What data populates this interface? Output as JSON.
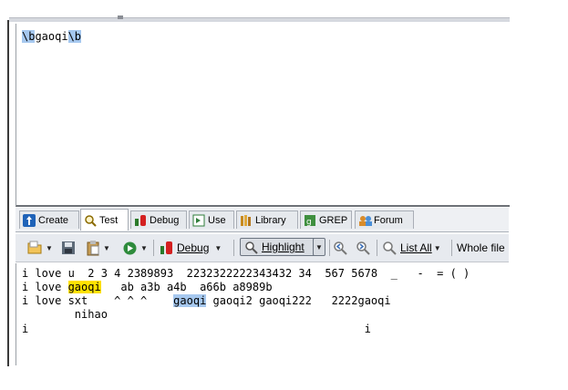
{
  "regex": {
    "pattern_parts": [
      {
        "text": "\\b",
        "highlight": "blue"
      },
      {
        "text": "gaoqi",
        "highlight": "none"
      },
      {
        "text": "\\b",
        "highlight": "blue"
      }
    ]
  },
  "tabs": [
    {
      "label": "Create",
      "icon": "create-icon",
      "active": false
    },
    {
      "label": "Test",
      "icon": "magnifier-icon",
      "active": true
    },
    {
      "label": "Debug",
      "icon": "debug-icon",
      "active": false
    },
    {
      "label": "Use",
      "icon": "use-icon",
      "active": false
    },
    {
      "label": "Library",
      "icon": "library-icon",
      "active": false
    },
    {
      "label": "GREP",
      "icon": "grep-icon",
      "active": false
    },
    {
      "label": "Forum",
      "icon": "forum-icon",
      "active": false
    }
  ],
  "toolbar": {
    "debug_label": "Debug",
    "highlight_label": "Highlight",
    "list_all_label": "List All",
    "scope_label": "Whole file"
  },
  "test_text": {
    "lines": [
      [
        {
          "text": "i love u  2 3 4 2389893  2232322222343432 34  567 5678  _   -  = ( )",
          "highlight": "none"
        }
      ],
      [
        {
          "text": "i love ",
          "highlight": "none"
        },
        {
          "text": "gaoqi",
          "highlight": "yellow"
        },
        {
          "text": "   ab a3b a4b  a66b a8989b",
          "highlight": "none"
        }
      ],
      [
        {
          "text": "i love sxt    ^ ^ ^    ",
          "highlight": "none"
        },
        {
          "text": "gaoqi",
          "highlight": "blue"
        },
        {
          "text": " gaoqi2 gaoqi222   2222gaoqi",
          "highlight": "none"
        }
      ],
      [
        {
          "text": "        nihao",
          "highlight": "none"
        }
      ],
      [
        {
          "text": "i                                                   i",
          "highlight": "none"
        }
      ]
    ]
  },
  "colors": {
    "selection_blue": "#a6c8ef",
    "match_yellow": "#ffe100"
  }
}
